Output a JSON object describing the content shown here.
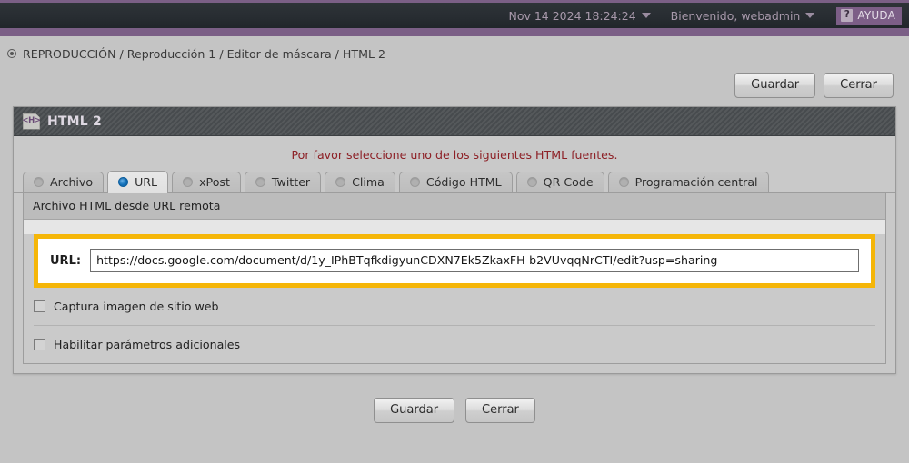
{
  "topbar": {
    "datetime": "Nov 14 2024 18:24:24",
    "user_greeting": "Bienvenido, webadmin",
    "help_label": "AYUDA",
    "help_question_mark": "?",
    "accent_color": "#7b5f86",
    "bar_color": "#282d32"
  },
  "breadcrumb": {
    "text": "REPRODUCCIÓN / Reproducción 1 / Editor de máscara / HTML 2"
  },
  "top_actions": {
    "save_label": "Guardar",
    "close_label": "Cerrar"
  },
  "panel": {
    "title": "HTML 2",
    "icon_text": "<H>",
    "notice": "Por favor seleccione uno de los siguientes HTML fuentes.",
    "notice_color": "#8d2026",
    "tabs": [
      {
        "label": "Archivo",
        "selected": false
      },
      {
        "label": "URL",
        "selected": true
      },
      {
        "label": "xPost",
        "selected": false
      },
      {
        "label": "Twitter",
        "selected": false
      },
      {
        "label": "Clima",
        "selected": false
      },
      {
        "label": "Código HTML",
        "selected": false
      },
      {
        "label": "QR Code",
        "selected": false
      },
      {
        "label": "Programación central",
        "selected": false
      }
    ],
    "section": {
      "heading": "Archivo HTML desde URL remota",
      "url_field": {
        "label": "URL:",
        "value": "https://docs.google.com/document/d/1y_IPhBTqfkdigyunCDXN7Ek5ZkaxFH-b2VUvqqNrCTI/edit?usp=sharing",
        "placeholder": "",
        "highlight_color": "#f5b608"
      },
      "options": [
        {
          "label": "Captura imagen de sitio web",
          "checked": false
        },
        {
          "label": "Habilitar parámetros adicionales",
          "checked": false
        }
      ]
    }
  },
  "bottom_actions": {
    "save_label": "Guardar",
    "close_label": "Cerrar"
  }
}
